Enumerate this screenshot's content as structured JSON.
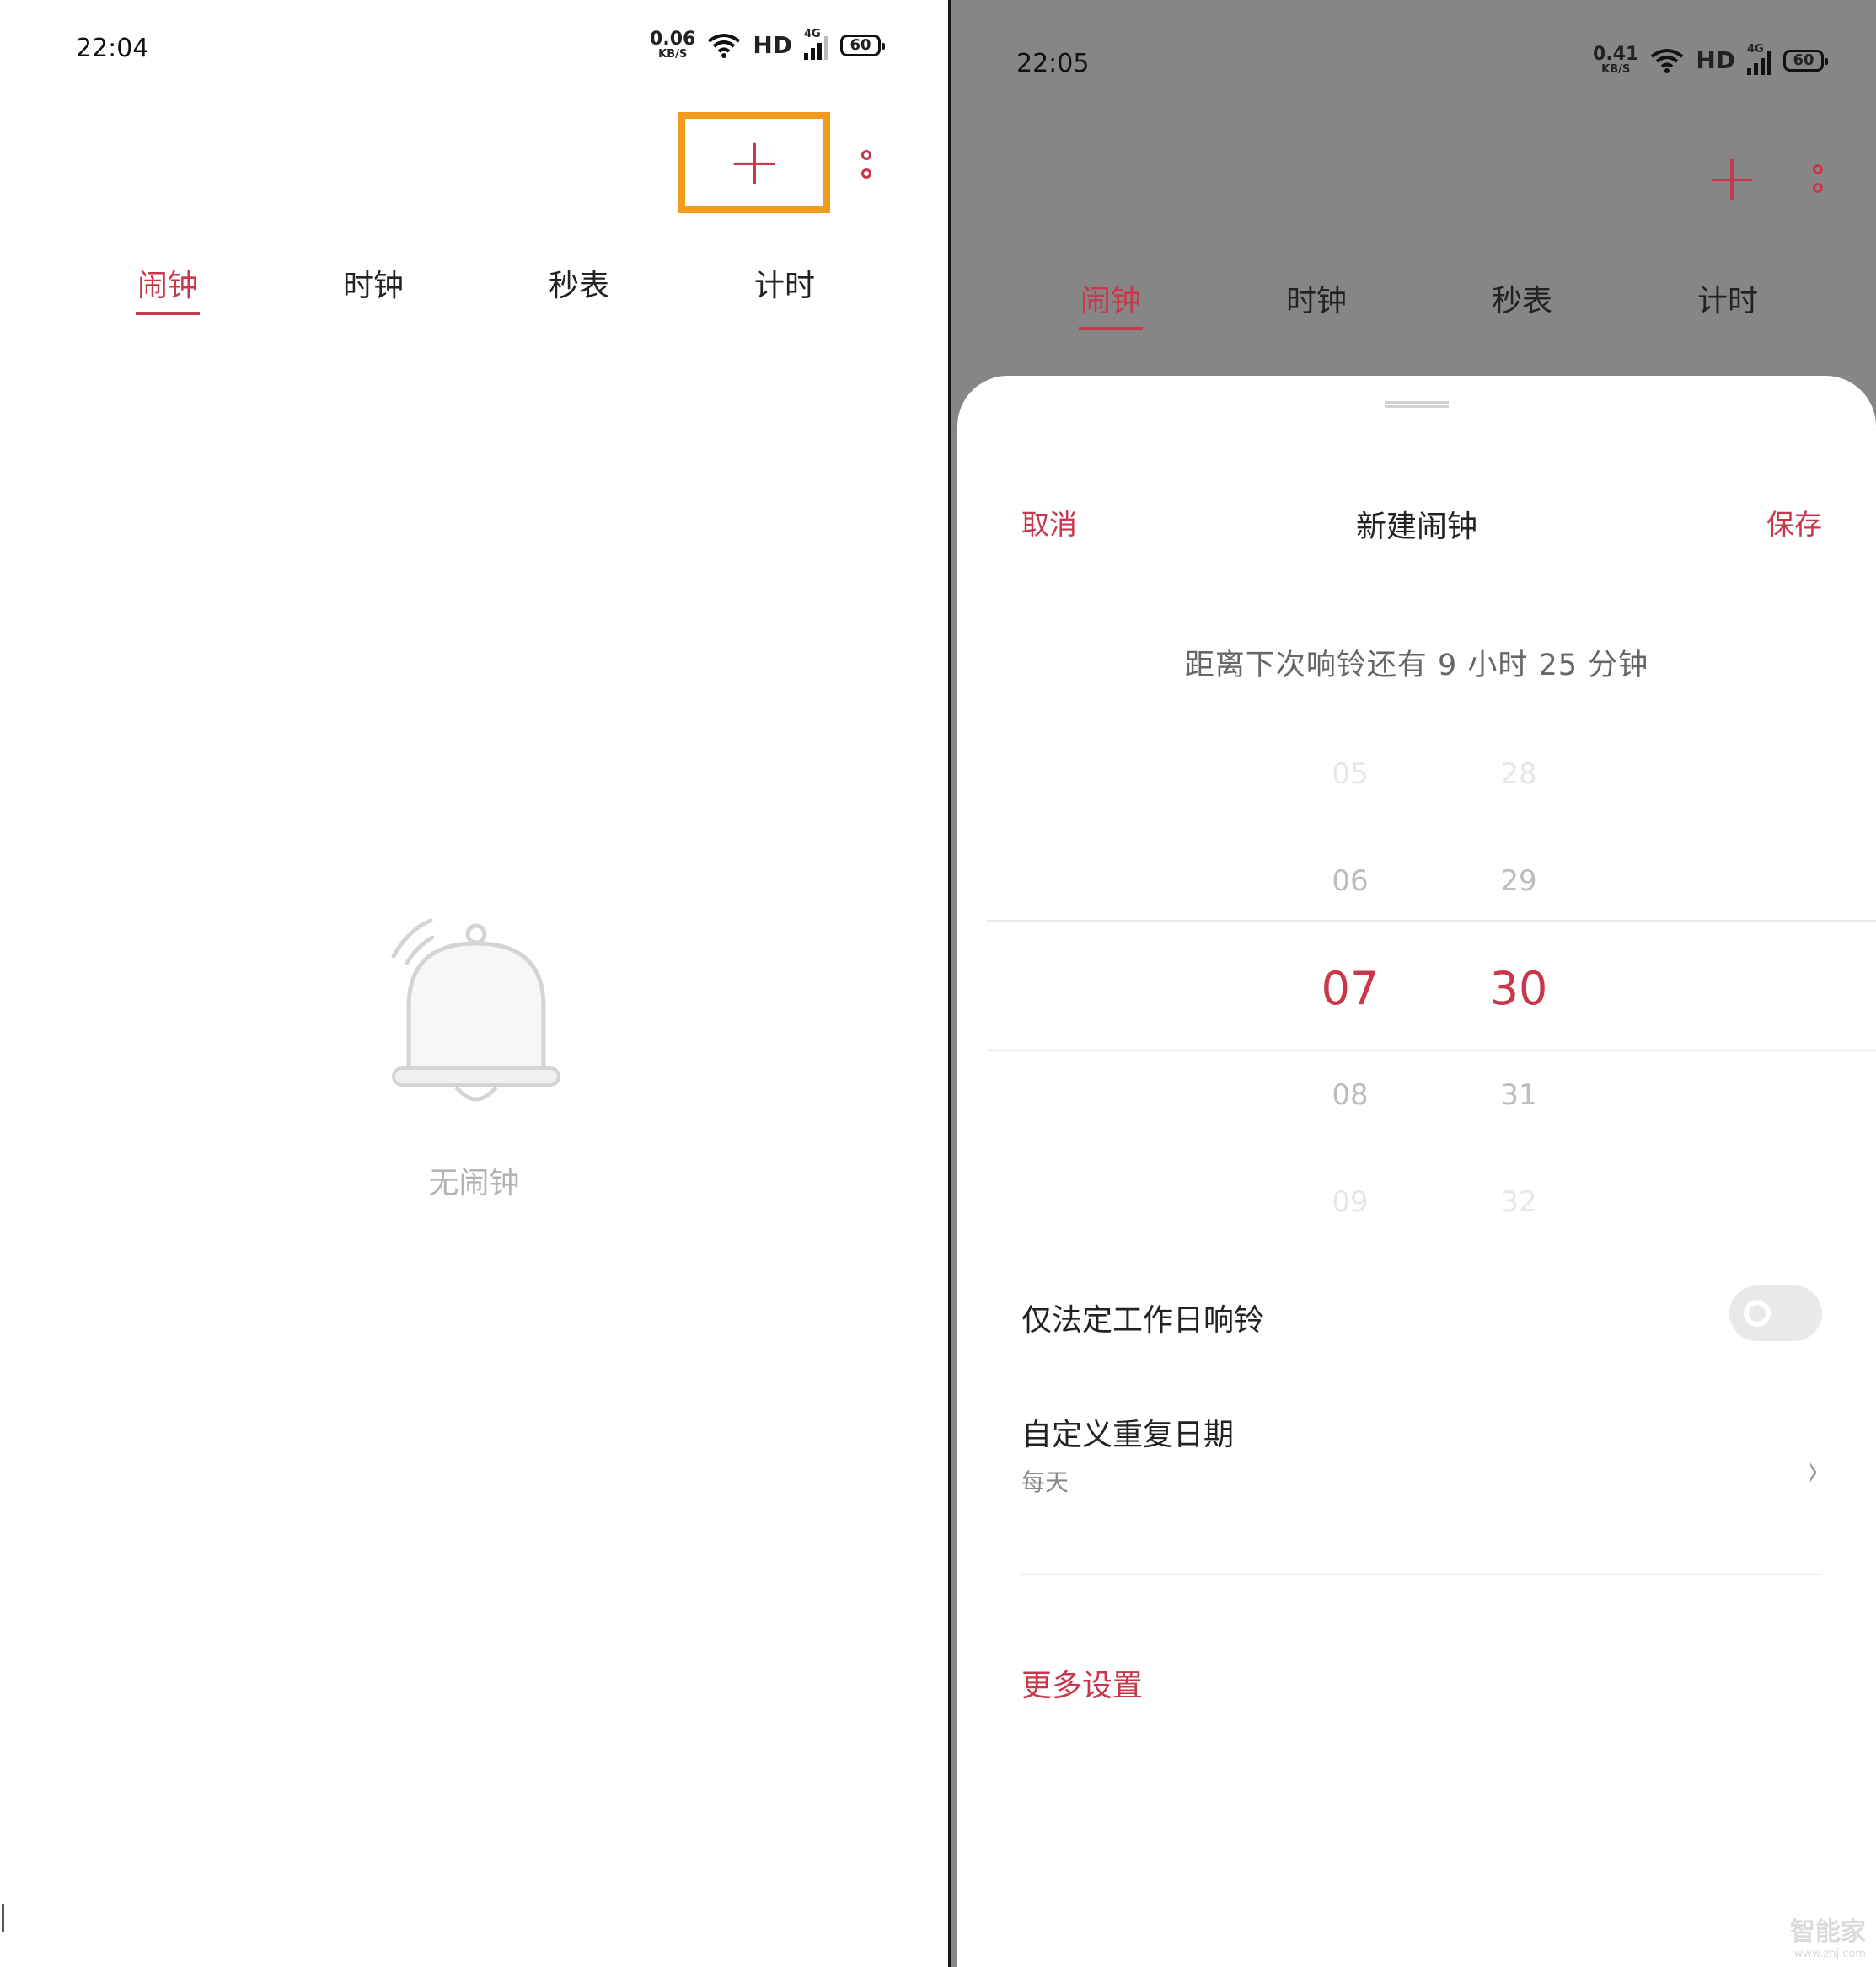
{
  "left_screen": {
    "status_bar": {
      "time": "22:04",
      "net_speed": "0.06",
      "net_unit": "KB/S",
      "hd": "HD",
      "signal": "4G",
      "battery": "60"
    },
    "toolbar": {
      "add_symbol": "+",
      "add_highlight_color": "#f39b1c"
    },
    "tabs": [
      {
        "label": "闹钟",
        "active": true
      },
      {
        "label": "时钟",
        "active": false
      },
      {
        "label": "秒表",
        "active": false
      },
      {
        "label": "计时",
        "active": false
      }
    ],
    "empty_state": {
      "icon": "bell-icon",
      "text": "无闹钟"
    }
  },
  "right_screen": {
    "status_bar": {
      "time": "22:05",
      "net_speed": "0.41",
      "net_unit": "KB/S",
      "hd": "HD",
      "signal": "4G",
      "battery": "60"
    },
    "toolbar": {
      "add_symbol": "+"
    },
    "tabs": [
      {
        "label": "闹钟",
        "active": true
      },
      {
        "label": "时钟",
        "active": false
      },
      {
        "label": "秒表",
        "active": false
      },
      {
        "label": "计时",
        "active": false
      }
    ],
    "sheet": {
      "cancel_label": "取消",
      "title": "新建闹钟",
      "save_label": "保存",
      "countdown_text": "距离下次响铃还有  9 小时 25 分钟",
      "picker": {
        "hours": [
          "05",
          "06",
          "07",
          "08",
          "09"
        ],
        "minutes": [
          "28",
          "29",
          "30",
          "31",
          "32"
        ],
        "selected_hour": "07",
        "selected_minute": "30"
      },
      "workday_only_label": "仅法定工作日响铃",
      "workday_only_enabled": false,
      "repeat_label": "自定义重复日期",
      "repeat_value": "每天",
      "more_settings_label": "更多设置"
    }
  },
  "watermark": {
    "main": "智能家",
    "sub": "www.znj.com"
  },
  "colors": {
    "accent": "#c8374b",
    "highlight": "#f39b1c",
    "overlay": "#868686"
  }
}
